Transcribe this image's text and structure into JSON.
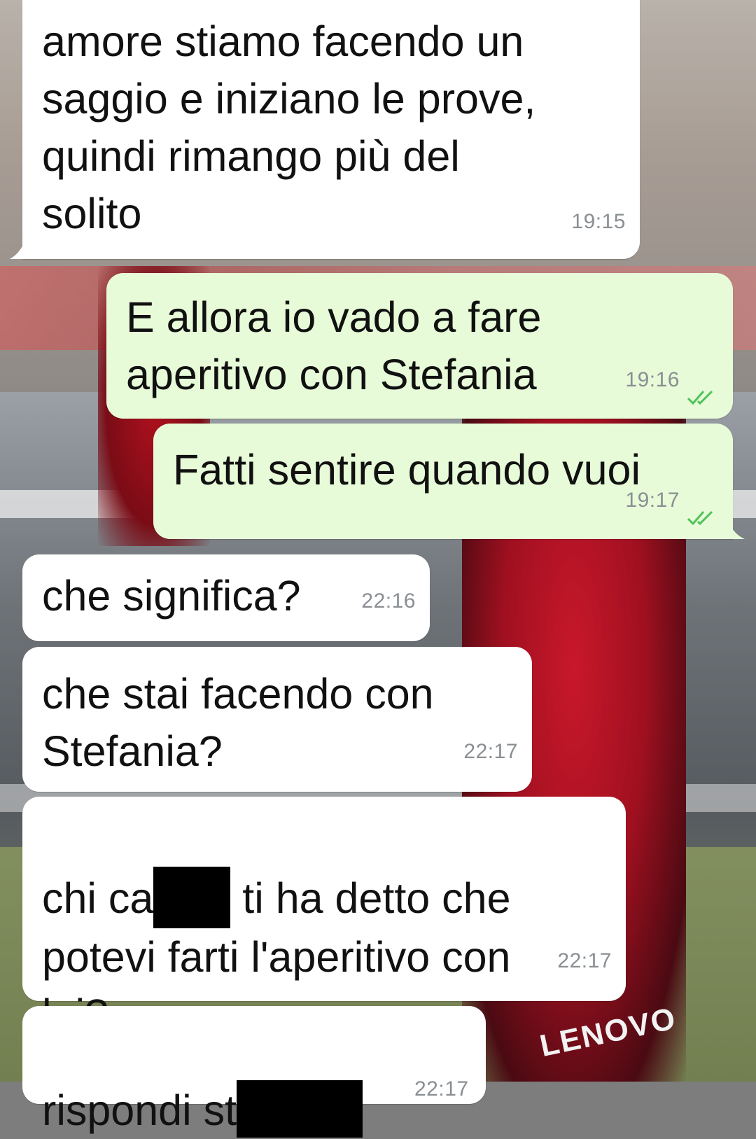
{
  "conversation": {
    "messages": [
      {
        "direction": "incoming",
        "text": "amore stiamo facendo un\nsaggio e iniziano le prove,\nquindi rimango più del\nsolito",
        "time": "19:15"
      },
      {
        "direction": "outgoing",
        "text": "E allora io vado a fare\naperitivo con Stefania",
        "time": "19:16",
        "status": "read"
      },
      {
        "direction": "outgoing",
        "text": "Fatti sentire quando vuoi",
        "time": "19:17",
        "status": "read"
      },
      {
        "direction": "incoming",
        "text": "che significa?",
        "time": "22:16"
      },
      {
        "direction": "incoming",
        "text": "che stai facendo con\nStefania?",
        "time": "22:17"
      },
      {
        "direction": "incoming",
        "text_parts": [
          "chi ca",
          "[redacted]",
          " ti ha detto che\npotevi farti l'aperitivo con\nlei?"
        ],
        "time": "22:17"
      },
      {
        "direction": "incoming",
        "text_parts": [
          "rispondi st",
          "[redacted]"
        ],
        "time": "22:17"
      }
    ]
  },
  "colors": {
    "incoming_bubble": "#ffffff",
    "outgoing_bubble": "#e7fbd8",
    "timestamp": "#8a8f93",
    "read_ticks": "#4fc35a"
  },
  "icons": {
    "read_receipt": "double-check-icon"
  },
  "wallpaper": {
    "logo_text": "LENOVO"
  }
}
